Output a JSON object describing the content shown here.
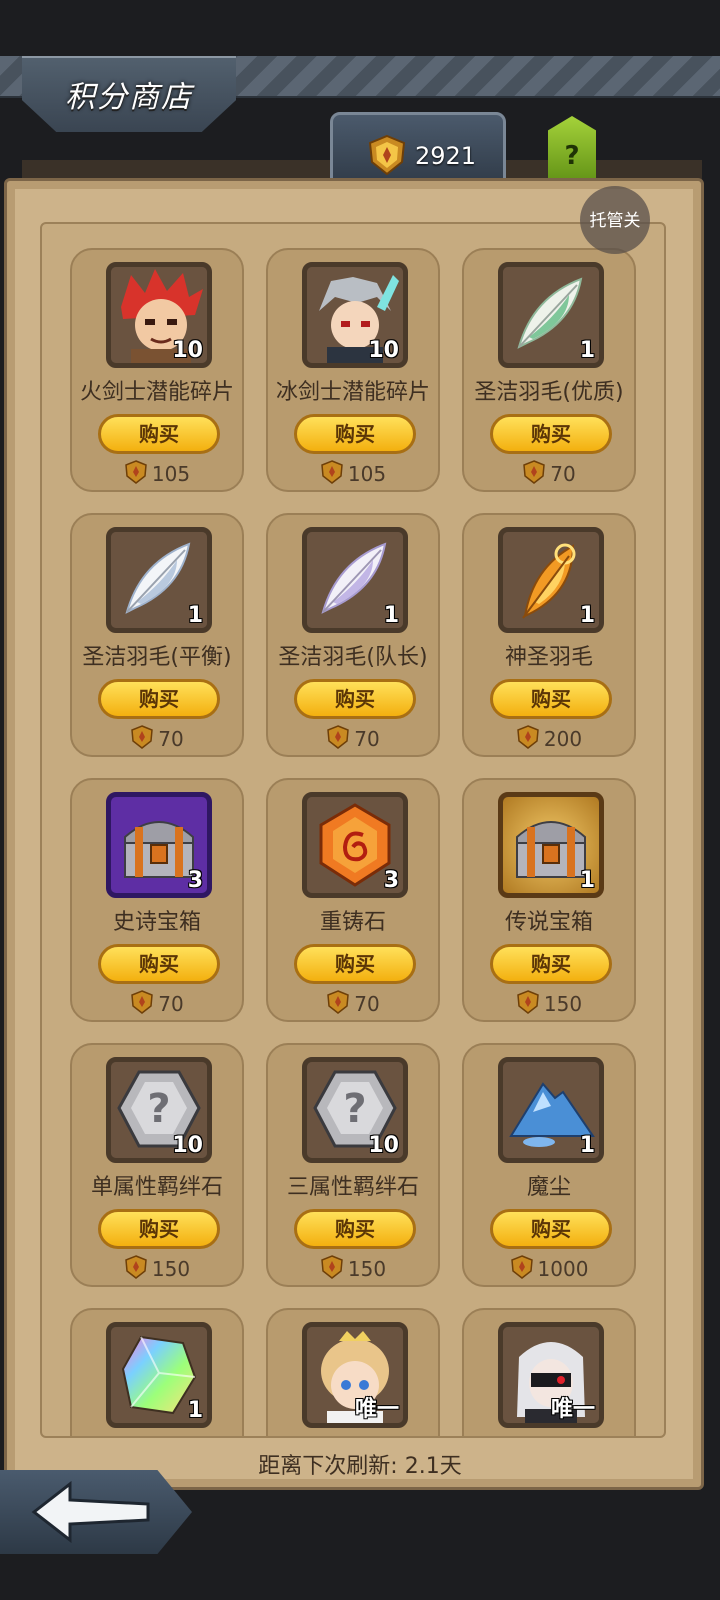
{
  "header": {
    "title": "积分商店",
    "currency_value": "2921",
    "help_label": "?"
  },
  "auto_toggle": {
    "label": "托管关"
  },
  "shop": {
    "items": [
      {
        "name": "火剑士潜能碎片",
        "qty": "10",
        "price": "105",
        "icon": "fire-swordsman-portrait-icon"
      },
      {
        "name": "冰剑士潜能碎片",
        "qty": "10",
        "price": "105",
        "icon": "ice-swordsman-portrait-icon"
      },
      {
        "name": "圣洁羽毛(优质)",
        "qty": "1",
        "price": "70",
        "icon": "green-feather-icon"
      },
      {
        "name": "圣洁羽毛(平衡)",
        "qty": "1",
        "price": "70",
        "icon": "white-feather-icon"
      },
      {
        "name": "圣洁羽毛(队长)",
        "qty": "1",
        "price": "70",
        "icon": "lavender-feather-icon"
      },
      {
        "name": "神圣羽毛",
        "qty": "1",
        "price": "200",
        "icon": "golden-feather-icon"
      },
      {
        "name": "史诗宝箱",
        "qty": "3",
        "price": "70",
        "icon": "epic-chest-icon"
      },
      {
        "name": "重铸石",
        "qty": "3",
        "price": "70",
        "icon": "reforge-stone-icon"
      },
      {
        "name": "传说宝箱",
        "qty": "1",
        "price": "150",
        "icon": "legendary-chest-icon"
      },
      {
        "name": "单属性羁绊石",
        "qty": "10",
        "price": "150",
        "icon": "mystery-gem-icon"
      },
      {
        "name": "三属性羁绊石",
        "qty": "10",
        "price": "150",
        "icon": "mystery-gem-icon"
      },
      {
        "name": "魔尘",
        "qty": "1",
        "price": "1000",
        "icon": "magic-dust-icon"
      },
      {
        "name": "",
        "qty": "1",
        "price": "",
        "icon": "rainbow-crystal-icon"
      },
      {
        "name": "",
        "qty": "唯一",
        "price": "",
        "icon": "blonde-hero-portrait-icon"
      },
      {
        "name": "",
        "qty": "唯一",
        "price": "",
        "icon": "masked-hero-portrait-icon"
      }
    ],
    "buy_label": "购买"
  },
  "footer": {
    "refresh_text": "距离下次刷新: 2.1天"
  },
  "colors": {
    "panel": "#cdb38a",
    "buy_button": "#f7c21a",
    "help_button": "#8fc12a"
  }
}
